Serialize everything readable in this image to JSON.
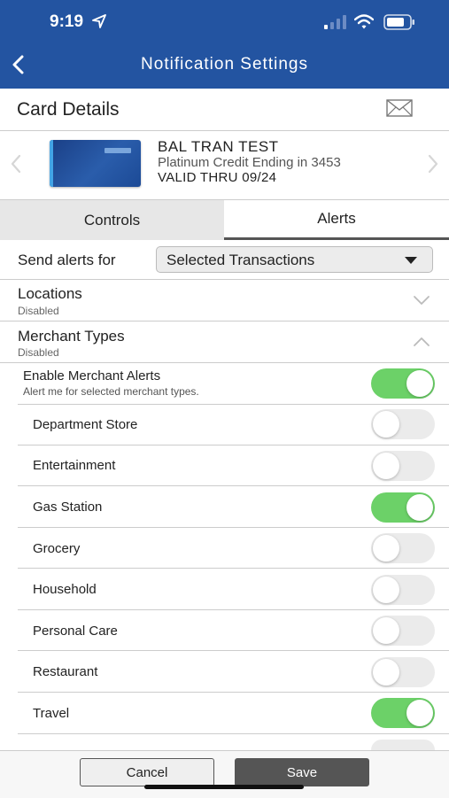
{
  "status_bar": {
    "time": "9:19"
  },
  "header": {
    "title": "Notification Settings",
    "back_icon": "chevron-left-icon",
    "color": "#2354a1"
  },
  "card_details": {
    "title": "Card Details",
    "mail_icon": "mail-icon",
    "card": {
      "name": "BAL TRAN TEST",
      "subtitle": "Platinum Credit Ending in 3453",
      "valid": "VALID THRU 09/24"
    }
  },
  "tabs": [
    {
      "label": "Controls",
      "selected": false
    },
    {
      "label": "Alerts",
      "selected": true
    }
  ],
  "send_alerts": {
    "label": "Send alerts for",
    "value": "Selected Transactions"
  },
  "sections": {
    "locations": {
      "title": "Locations",
      "status": "Disabled",
      "expanded": false
    },
    "merchant_types": {
      "title": "Merchant Types",
      "status": "Disabled",
      "expanded": true
    }
  },
  "enable_alerts": {
    "title": "Enable Merchant Alerts",
    "subtitle": "Alert me for selected merchant types.",
    "on": true
  },
  "merchants": [
    {
      "label": "Department Store",
      "on": false
    },
    {
      "label": "Entertainment",
      "on": false
    },
    {
      "label": "Gas Station",
      "on": true
    },
    {
      "label": "Grocery",
      "on": false
    },
    {
      "label": "Household",
      "on": false
    },
    {
      "label": "Personal Care",
      "on": false
    },
    {
      "label": "Restaurant",
      "on": false
    },
    {
      "label": "Travel",
      "on": true
    }
  ],
  "footer": {
    "cancel_label": "Cancel",
    "save_label": "Save"
  },
  "colors": {
    "toggle_on": "#6cd168",
    "toggle_off": "#ebebeb"
  }
}
